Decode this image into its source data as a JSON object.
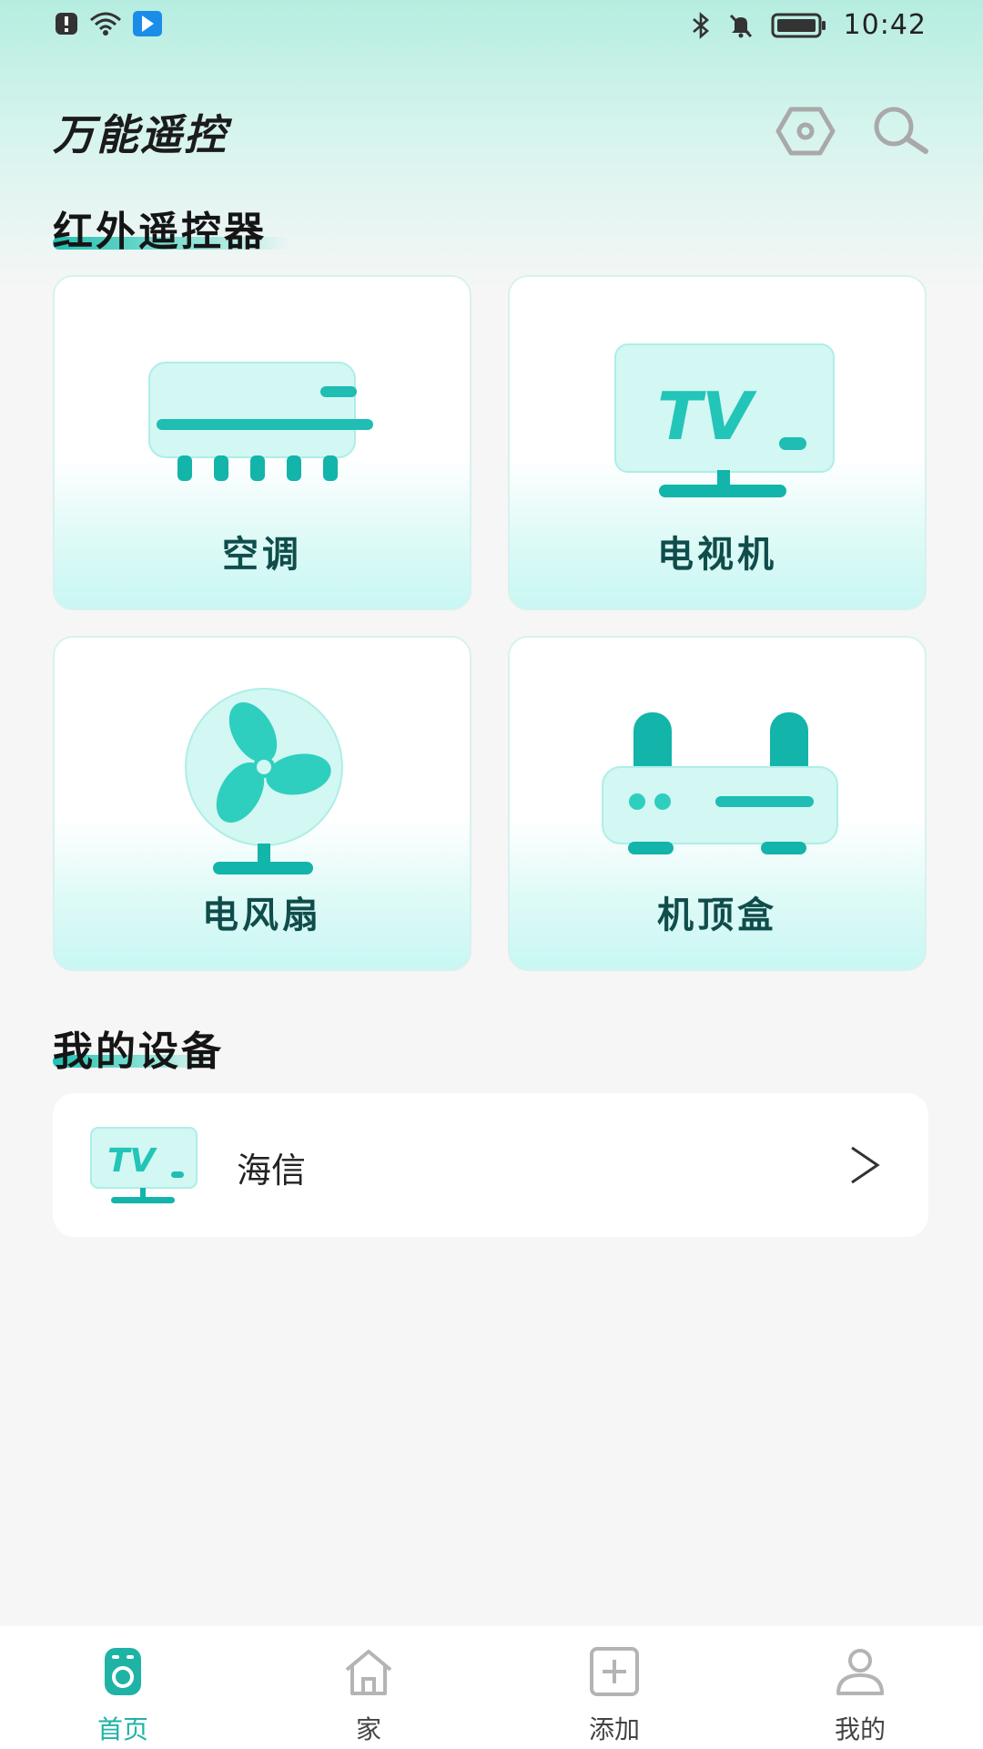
{
  "status_bar": {
    "time": "10:42"
  },
  "header": {
    "title": "万能遥控"
  },
  "ir_section": {
    "title": "红外遥控器",
    "items": [
      {
        "label": "空调",
        "icon": "air-conditioner-icon"
      },
      {
        "label": "电视机",
        "icon": "tv-icon"
      },
      {
        "label": "电风扇",
        "icon": "fan-icon"
      },
      {
        "label": "机顶盒",
        "icon": "set-top-box-icon"
      }
    ]
  },
  "devices_section": {
    "title": "我的设备",
    "items": [
      {
        "name": "海信",
        "icon": "tv-icon"
      }
    ]
  },
  "tv_logo_text": "TV",
  "bottom_nav": {
    "items": [
      {
        "label": "首页",
        "active": true
      },
      {
        "label": "家",
        "active": false
      },
      {
        "label": "添加",
        "active": false
      },
      {
        "label": "我的",
        "active": false
      }
    ]
  },
  "colors": {
    "accent": "#1fb3a6",
    "card_label": "#0f4d4b",
    "icon_teal": "#18bdb3"
  }
}
